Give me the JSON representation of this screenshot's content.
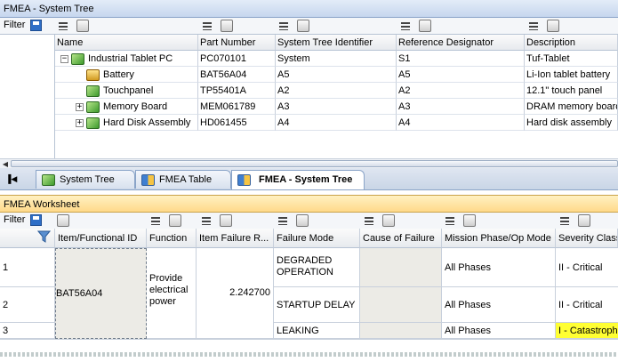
{
  "tree_pane": {
    "title": "FMEA - System Tree",
    "filter_label": "Filter",
    "columns": [
      "Name",
      "Part Number",
      "System Tree Identifier",
      "Reference Designator",
      "Description"
    ],
    "rows": [
      {
        "name": "Industrial Tablet PC",
        "part": "PC070101",
        "sti": "System",
        "ref": "S1",
        "desc": "Tuf-Tablet",
        "expander": "−",
        "icon": "assembly-icon"
      },
      {
        "name": "Battery",
        "part": "BAT56A04",
        "sti": "A5",
        "ref": "A5",
        "desc": "Li-Ion tablet battery",
        "expander": "",
        "icon": "battery-icon"
      },
      {
        "name": "Touchpanel",
        "part": "TP55401A",
        "sti": "A2",
        "ref": "A2",
        "desc": "12.1\" touch panel",
        "expander": "",
        "icon": "assembly-icon"
      },
      {
        "name": "Memory Board",
        "part": "MEM061789",
        "sti": "A3",
        "ref": "A3",
        "desc": "DRAM memory board",
        "expander": "+",
        "icon": "assembly-icon"
      },
      {
        "name": "Hard Disk Assembly",
        "part": "HD061455",
        "sti": "A4",
        "ref": "A4",
        "desc": "Hard disk assembly",
        "expander": "+",
        "icon": "assembly-icon"
      }
    ]
  },
  "tabs": [
    {
      "label": "System Tree",
      "active": false
    },
    {
      "label": "FMEA Table",
      "active": false
    },
    {
      "label": "FMEA - System Tree",
      "active": true
    }
  ],
  "worksheet": {
    "title": "FMEA Worksheet",
    "filter_label": "Filter",
    "columns": [
      "Item/Functional ID",
      "Function",
      "Item Failure R...",
      "Failure Mode",
      "Cause of Failure",
      "Mission Phase/Op Mode",
      "Severity Class"
    ],
    "item_id": "BAT56A04",
    "function": [
      "Provide",
      "electrical",
      "power"
    ],
    "failure_rate": "2.242700",
    "rows": [
      {
        "num": "1",
        "mode": [
          "DEGRADED",
          "OPERATION"
        ],
        "phase": "All Phases",
        "severity": "II - Critical"
      },
      {
        "num": "2",
        "mode": [
          "STARTUP DELAY"
        ],
        "phase": "All Phases",
        "severity": "II - Critical"
      },
      {
        "num": "3",
        "mode": [
          "LEAKING"
        ],
        "phase": "All Phases",
        "severity": "I - Catastrophic"
      }
    ]
  },
  "colors": {
    "severity_highlight": "#ffff33",
    "tree_header": "#c6d6ee",
    "worksheet_header": "#ffd98a"
  }
}
